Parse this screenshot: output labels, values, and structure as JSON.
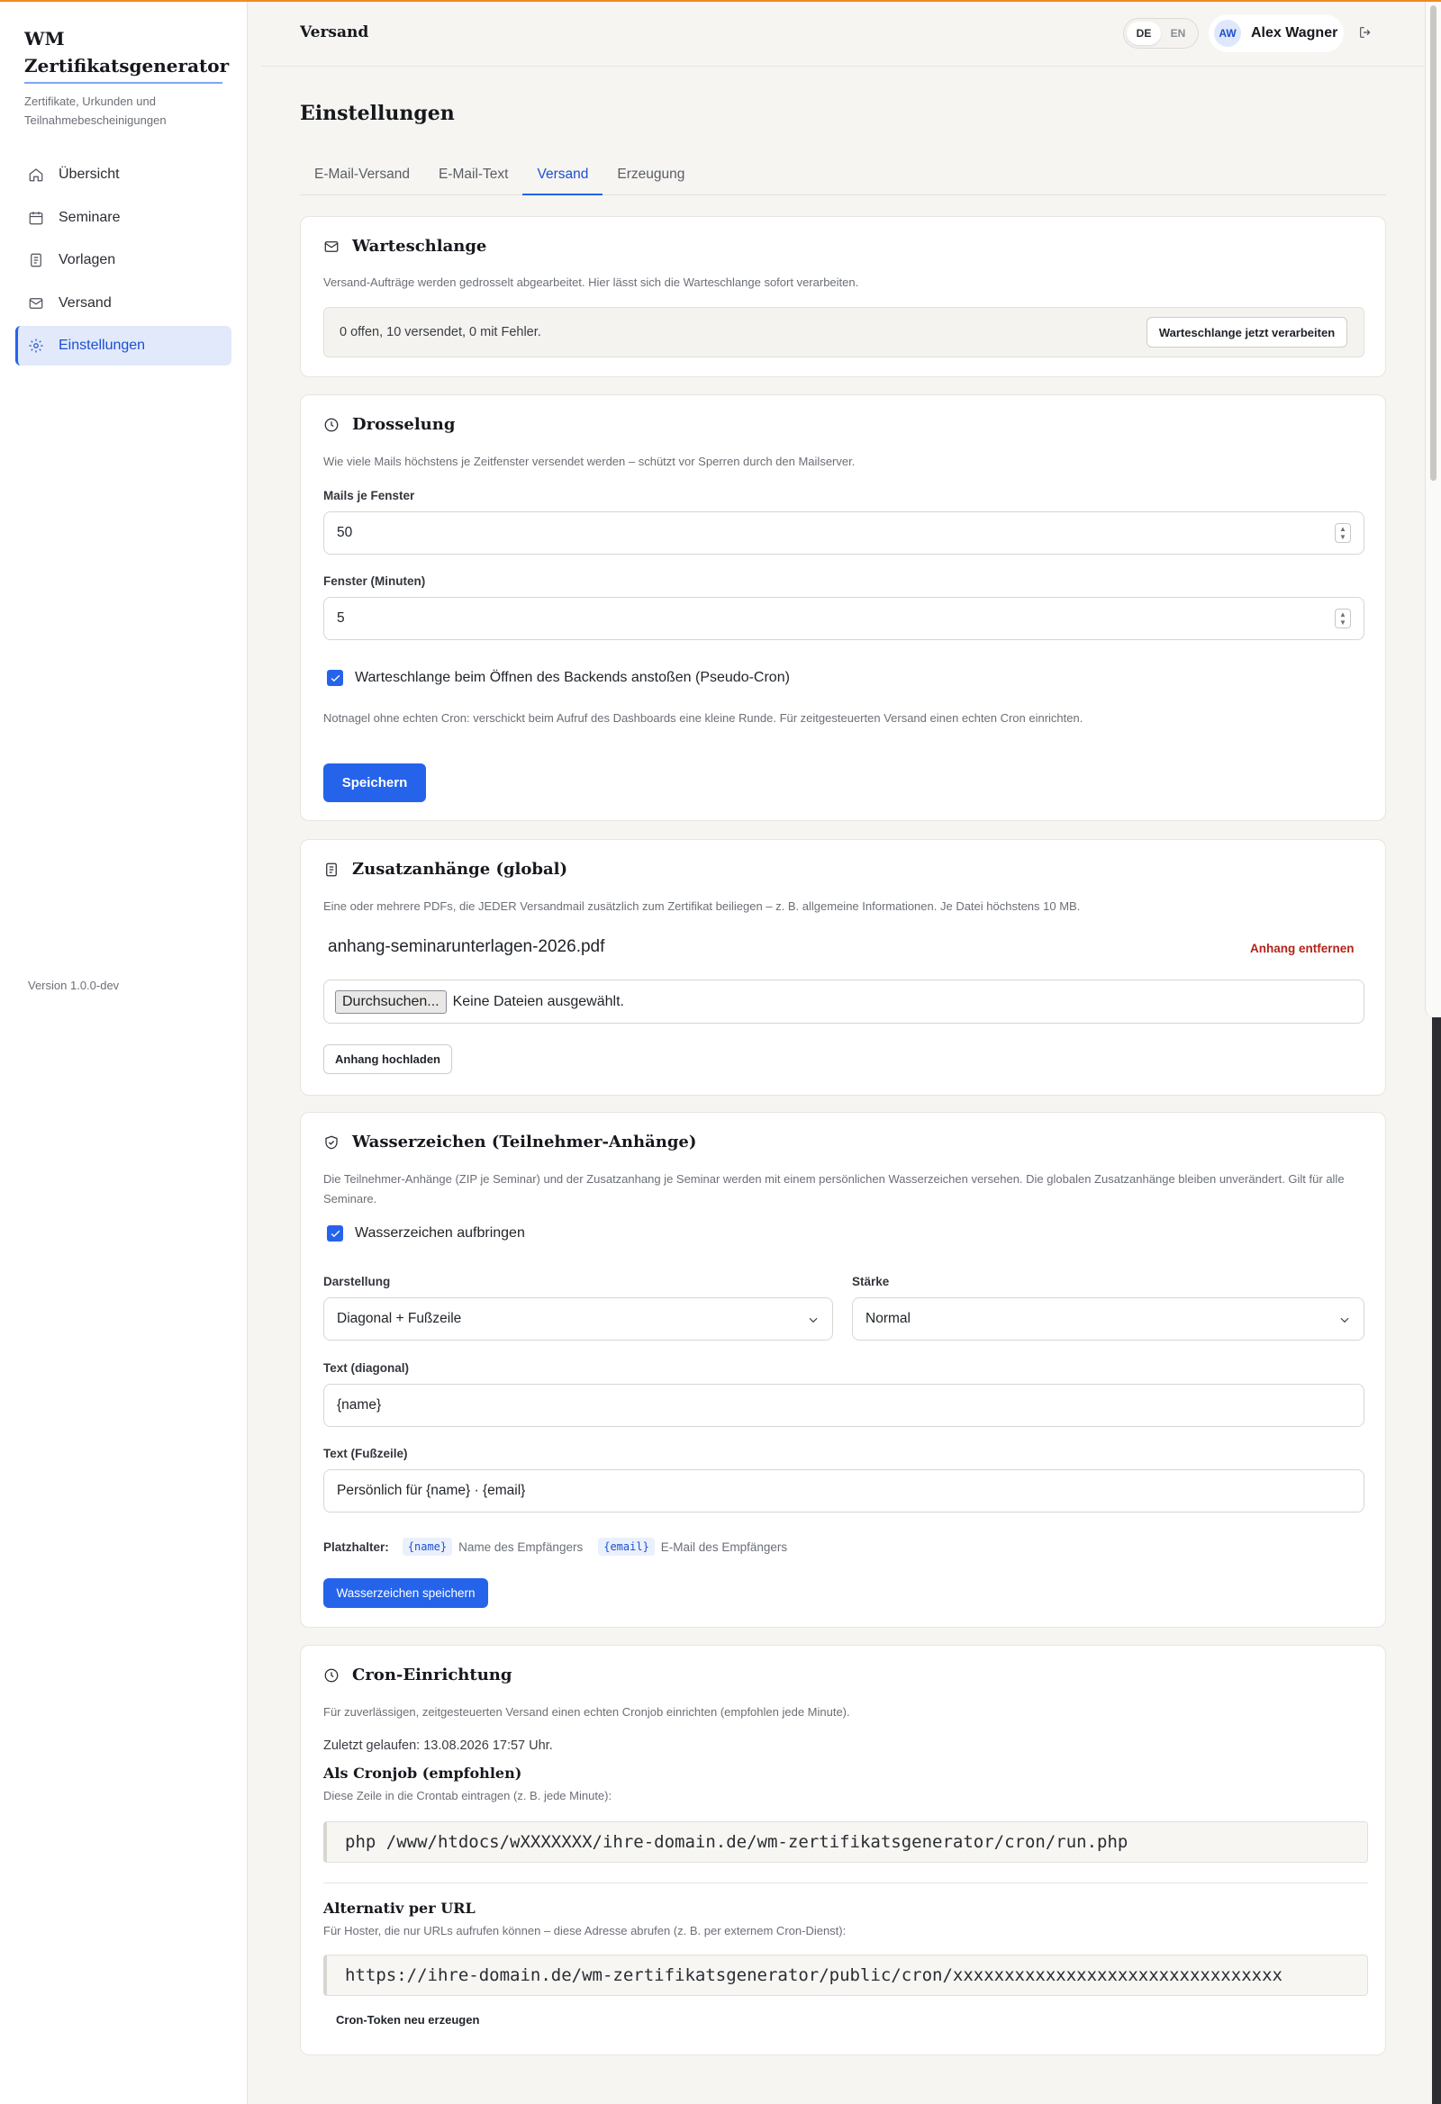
{
  "brand": {
    "title": "WM Zertifikatsgenerator",
    "subtitle": "Zertifikate, Urkunden und Teilnahmebescheinigungen"
  },
  "sidebar": {
    "items": [
      {
        "label": "Übersicht",
        "icon": "home-icon"
      },
      {
        "label": "Seminare",
        "icon": "calendar-icon"
      },
      {
        "label": "Vorlagen",
        "icon": "document-icon"
      },
      {
        "label": "Versand",
        "icon": "mail-icon"
      },
      {
        "label": "Einstellungen",
        "icon": "gear-icon",
        "active": true
      }
    ],
    "version": "Version 1.0.0-dev"
  },
  "topbar": {
    "title": "Versand",
    "lang": {
      "de": "DE",
      "en": "EN",
      "selected": "DE"
    },
    "user": {
      "initials": "AW",
      "name": "Alex Wagner"
    }
  },
  "page": {
    "title": "Einstellungen",
    "tabs": [
      "E-Mail-Versand",
      "E-Mail-Text",
      "Versand",
      "Erzeugung"
    ],
    "active_tab": "Versand"
  },
  "queue": {
    "title": "Warteschlange",
    "desc": "Versand-Aufträge werden gedrosselt abgearbeitet. Hier lässt sich die Warteschlange sofort verarbeiten.",
    "status": "0 offen, 10 versendet, 0 mit Fehler.",
    "button": "Warteschlange jetzt verarbeiten"
  },
  "throttle": {
    "title": "Drosselung",
    "desc": "Wie viele Mails höchstens je Zeitfenster versendet werden – schützt vor Sperren durch den Mailserver.",
    "mails_label": "Mails je Fenster",
    "mails_value": "50",
    "window_label": "Fenster (Minuten)",
    "window_value": "5",
    "pseudo_cron_label": "Warteschlange beim Öffnen des Backends anstoßen (Pseudo-Cron)",
    "pseudo_cron_checked": true,
    "hint": "Notnagel ohne echten Cron: verschickt beim Aufruf des Dashboards eine kleine Runde. Für zeitgesteuerten Versand einen echten Cron einrichten.",
    "save": "Speichern"
  },
  "attachments": {
    "title": "Zusatzanhänge (global)",
    "desc": "Eine oder mehrere PDFs, die JEDER Versandmail zusätzlich zum Zertifikat beiliegen – z. B. allgemeine Informationen. Je Datei höchstens 10 MB.",
    "file_name": "anhang-seminarunterlagen-2026.pdf",
    "remove": "Anhang entfernen",
    "browse": "Durchsuchen...",
    "no_file": "Keine Dateien ausgewählt.",
    "upload": "Anhang hochladen"
  },
  "watermark": {
    "title": "Wasserzeichen (Teilnehmer-Anhänge)",
    "desc": "Die Teilnehmer-Anhänge (ZIP je Seminar) und der Zusatzanhang je Seminar werden mit einem persönlichen Wasserzeichen versehen. Die globalen Zusatzanhänge bleiben unverändert. Gilt für alle Seminare.",
    "enable_label": "Wasserzeichen aufbringen",
    "enabled": true,
    "style_label": "Darstellung",
    "style_value": "Diagonal + Fußzeile",
    "strength_label": "Stärke",
    "strength_value": "Normal",
    "diag_label": "Text (diagonal)",
    "diag_value": "{name}",
    "footer_label": "Text (Fußzeile)",
    "footer_value": "Persönlich für {name} · {email}",
    "placeholders_label": "Platzhalter:",
    "ph1": "{name}",
    "ph1_desc": "Name des Empfängers",
    "ph2": "{email}",
    "ph2_desc": "E-Mail des Empfängers",
    "save": "Wasserzeichen speichern"
  },
  "cron": {
    "title": "Cron-Einrichtung",
    "desc": "Für zuverlässigen, zeitgesteuerten Versand einen echten Cronjob einrichten (empfohlen jede Minute).",
    "last_run": "Zuletzt gelaufen: 13.08.2026 17:57 Uhr.",
    "cronjob_title": "Als Cronjob (empfohlen)",
    "cronjob_desc": "Diese Zeile in die Crontab eintragen (z. B. jede Minute):",
    "cronjob_cmd": "php /www/htdocs/wXXXXXXX/ihre-domain.de/wm-zertifikatsgenerator/cron/run.php",
    "url_title": "Alternativ per URL",
    "url_desc": "Für Hoster, die nur URLs aufrufen können – diese Adresse abrufen (z. B. per externem Cron-Dienst):",
    "url": "https://ihre-domain.de/wm-zertifikatsgenerator/public/cron/xxxxxxxxxxxxxxxxxxxxxxxxxxxxxxxx",
    "regenerate": "Cron-Token neu erzeugen"
  },
  "colors": {
    "accent": "#2563eb",
    "danger": "#b42318",
    "topline": "#f08a24"
  }
}
